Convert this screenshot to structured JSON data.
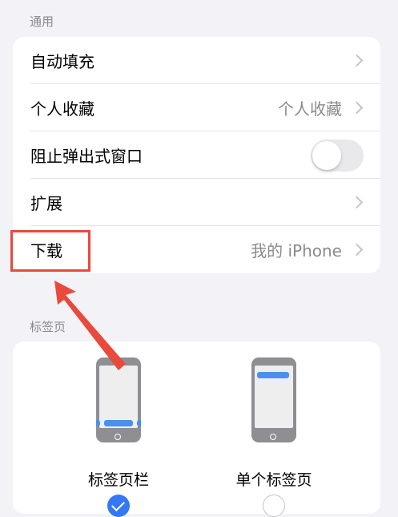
{
  "general_section": {
    "header": "通用",
    "rows": [
      {
        "label": "自动填充",
        "value": "",
        "control": "chevron"
      },
      {
        "label": "个人收藏",
        "value": "个人收藏",
        "control": "chevron"
      },
      {
        "label": "阻止弹出式窗口",
        "value": "",
        "control": "toggle",
        "toggle_on": false
      },
      {
        "label": "扩展",
        "value": "",
        "control": "chevron"
      },
      {
        "label": "下载",
        "value": "我的 iPhone",
        "control": "chevron",
        "highlighted": true
      }
    ]
  },
  "tabs_section": {
    "header": "标签页",
    "options": [
      {
        "label": "标签页栏",
        "selected": true
      },
      {
        "label": "单个标签页",
        "selected": false
      }
    ]
  },
  "annotation": {
    "color": "#e84a3b"
  },
  "colors": {
    "background": "#f2f2f7",
    "accent": "#3478f6",
    "bar_blue": "#4b8ff0"
  }
}
